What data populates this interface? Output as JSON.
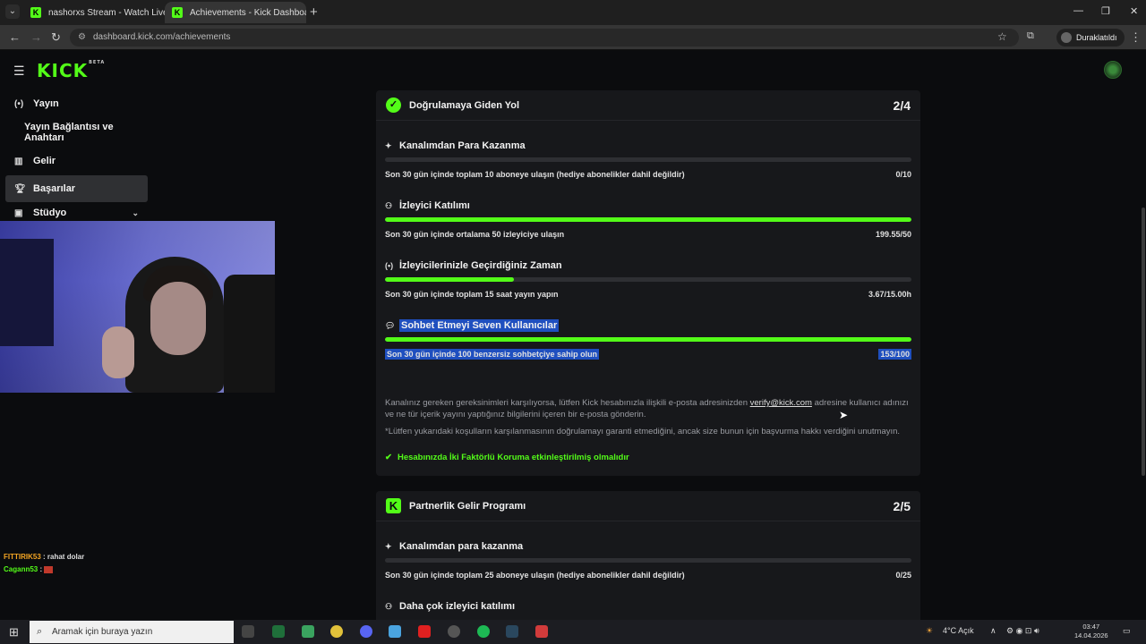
{
  "browser": {
    "tabs": [
      {
        "label": "nashorxs Stream - Watch Live o",
        "active": false
      },
      {
        "label": "Achievements - Kick Dashboard",
        "active": true
      }
    ],
    "url": "dashboard.kick.com/achievements",
    "profile_label": "Duraklatıldı"
  },
  "app": {
    "logo": "KICK",
    "logo_badge": "BETA"
  },
  "sidebar": {
    "items": [
      {
        "label": "Yayın",
        "icon": "broadcast-icon"
      },
      {
        "label": "Yayın Bağlantısı ve Anahtarı",
        "icon": ""
      },
      {
        "label": "Gelir",
        "icon": "chart-icon"
      },
      {
        "label": "Başarılar",
        "icon": "trophy-icon",
        "active": true
      },
      {
        "label": "Stüdyo",
        "icon": "studio-icon"
      }
    ]
  },
  "chat": [
    {
      "user": "FITTIRIK53",
      "message": ": rahat dolar"
    },
    {
      "user": "Cagann53",
      "message": ":"
    }
  ],
  "verification": {
    "title": "Doğrulamaya Giden Yol",
    "count": "2/4",
    "achievements": [
      {
        "title": "Kanalımdan Para Kazanma",
        "desc": "Son 30 gün içinde toplam 10 aboneye ulaşın (hediye abonelikler dahil değildir)",
        "value": "0/10",
        "progress": 0
      },
      {
        "title": "İzleyici Katılımı",
        "desc": "Son 30 gün içinde ortalama 50 izleyiciye ulaşın",
        "value": "199.55/50",
        "progress": 1
      },
      {
        "title": "İzleyicilerinizle Geçirdiğiniz Zaman",
        "desc": "Son 30 gün içinde toplam 15 saat yayın yapın",
        "value": "3.67/15.00h",
        "progress": 0.245
      },
      {
        "title": "Sohbet Etmeyi Seven Kullanıcılar",
        "desc": "Son 30 gün içinde 100 benzersiz sohbetçiye sahip olun",
        "value": "153/100",
        "progress": 1
      }
    ],
    "note1_before": "Kanalınız gereken gereksinimleri karşılıyorsa, lütfen Kick hesabınızla ilişkili e-posta adresinizden ",
    "note1_email": "verify@kick.com",
    "note1_after": " adresine kullanıcı adınızı ve ne tür içerik yayını yaptığınız bilgilerini içeren bir e-posta gönderin.",
    "note2": "*Lütfen yukarıdaki koşulların karşılanmasının doğrulamayı garanti etmediğini, ancak size bunun için başvurma hakkı verdiğini unutmayın.",
    "tfa": "Hesabınızda İki Faktörlü Koruma etkinleştirilmiş olmalıdır"
  },
  "partner": {
    "title": "Partnerlik Gelir Programı",
    "count": "2/5",
    "achievements": [
      {
        "title": "Kanalımdan para kazanma",
        "desc": "Son 30 gün içinde toplam 25 aboneye ulaşın (hediye abonelikler dahil değildir)",
        "value": "0/25",
        "progress": 0
      },
      {
        "title": "Daha çok izleyici katılımı"
      }
    ]
  },
  "taskbar": {
    "search_placeholder": "Aramak için buraya yazın",
    "weather": "4°C  Açık",
    "time": "03:47",
    "date": "14.04.2026"
  },
  "colors": {
    "accent": "#53fc18",
    "selection": "#1f4fbf",
    "card_bg": "#17181b"
  }
}
